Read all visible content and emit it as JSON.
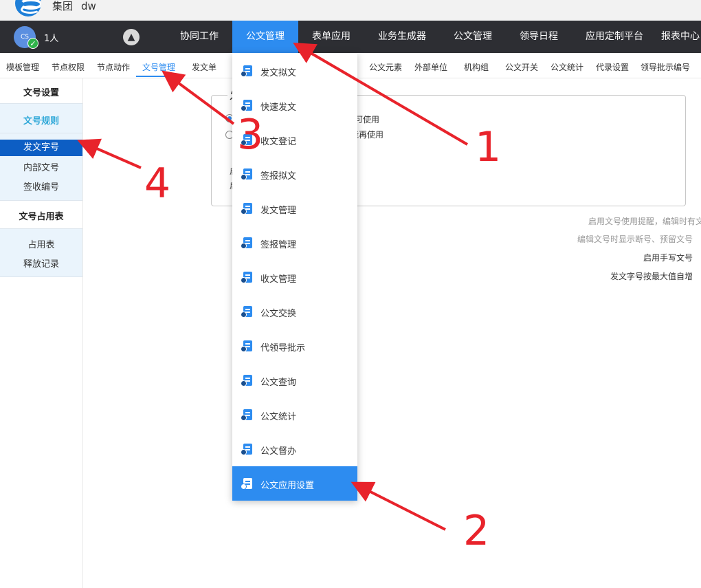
{
  "titlebar": {
    "company": "集团",
    "user": "dw"
  },
  "topnav": {
    "avatar_initials": "CS",
    "people_count": "1人",
    "items": [
      {
        "label": "协同工作",
        "active": false
      },
      {
        "label": "公文管理",
        "active": true
      },
      {
        "label": "表单应用",
        "active": false
      },
      {
        "label": "业务生成器",
        "active": false
      },
      {
        "label": "公文管理",
        "active": false
      },
      {
        "label": "领导日程",
        "active": false
      },
      {
        "label": "应用定制平台",
        "active": false
      },
      {
        "label": "报表中心",
        "active": false
      }
    ]
  },
  "subnav": {
    "items": [
      {
        "label": "模板管理"
      },
      {
        "label": "节点权限"
      },
      {
        "label": "节点动作"
      },
      {
        "label": "文号管理",
        "active": true
      },
      {
        "label": "发文单"
      },
      {
        "label": "公文元素"
      },
      {
        "label": "外部单位"
      },
      {
        "label": "机构组"
      },
      {
        "label": "公文开关"
      },
      {
        "label": "公文统计"
      },
      {
        "label": "代录设置"
      },
      {
        "label": "领导批示编号"
      }
    ]
  },
  "sidebar": {
    "section1_title": "文号设置",
    "rule_label": "文号规则",
    "items": [
      "发文字号",
      "内部文号",
      "签收编号"
    ],
    "section2_title": "文号占用表",
    "items2": [
      "占用表",
      "释放记录"
    ]
  },
  "content": {
    "legend": "发",
    "radio1_text": "可使用",
    "radio2_text": "能再使用",
    "small1": "启",
    "small2": "启",
    "right_lines": [
      "启用文号使用提醒，编辑时有文",
      "编辑文号时显示断号、预留文号",
      "启用手写文号",
      "发文字号按最大值自增"
    ]
  },
  "dropdown": {
    "items": [
      {
        "label": "发文拟文"
      },
      {
        "label": "快速发文"
      },
      {
        "label": "收文登记"
      },
      {
        "label": "签报拟文"
      },
      {
        "label": "发文管理"
      },
      {
        "label": "签报管理"
      },
      {
        "label": "收文管理"
      },
      {
        "label": "公文交换"
      },
      {
        "label": "代领导批示"
      },
      {
        "label": "公文查询"
      },
      {
        "label": "公文统计"
      },
      {
        "label": "公文督办"
      },
      {
        "label": "公文应用设置",
        "active": true
      }
    ]
  },
  "annotations": [
    "1",
    "2",
    "3",
    "4"
  ],
  "colors": {
    "accent": "#2d8cf0",
    "nav_bg": "#2d2e33",
    "annotation": "#e8232b",
    "sidebar_selected": "#0d5ec4"
  }
}
